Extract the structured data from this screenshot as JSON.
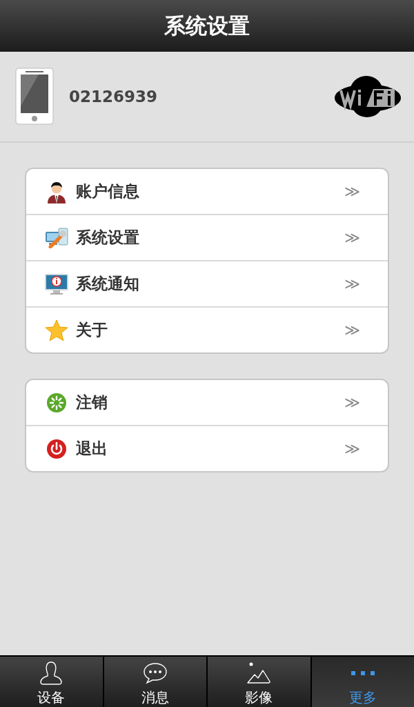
{
  "header": {
    "title": "系统设置"
  },
  "device": {
    "id": "02126939"
  },
  "groups": [
    {
      "items": [
        {
          "kind": "account",
          "label": "账户信息",
          "arrow": "≫"
        },
        {
          "kind": "settings",
          "label": "系统设置",
          "arrow": "≫"
        },
        {
          "kind": "notice",
          "label": "系统通知",
          "arrow": "≫"
        },
        {
          "kind": "about",
          "label": "关于",
          "arrow": "≫"
        }
      ]
    },
    {
      "items": [
        {
          "kind": "logout",
          "label": "注销",
          "arrow": "≫"
        },
        {
          "kind": "power",
          "label": "退出",
          "arrow": "≫"
        }
      ]
    }
  ],
  "tabs": [
    {
      "kind": "device",
      "label": "设备",
      "selected": false
    },
    {
      "kind": "message",
      "label": "消息",
      "selected": false
    },
    {
      "kind": "image",
      "label": "影像",
      "selected": false
    },
    {
      "kind": "more",
      "label": "更多",
      "selected": true
    }
  ]
}
